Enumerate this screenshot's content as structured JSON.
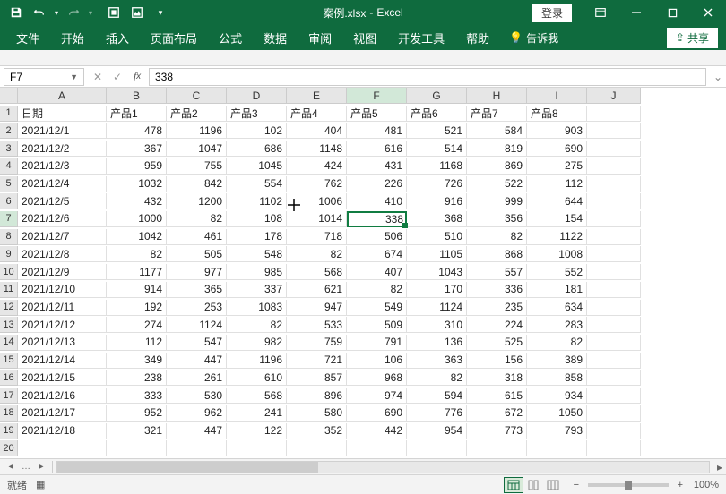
{
  "title": {
    "filename": "案例.xlsx",
    "app": "Excel"
  },
  "login": "登录",
  "ribbon": {
    "file": "文件",
    "home": "开始",
    "insert": "插入",
    "layout": "页面布局",
    "formula": "公式",
    "data": "数据",
    "review": "审阅",
    "view": "视图",
    "dev": "开发工具",
    "help": "帮助",
    "tellme": "告诉我",
    "share": "共享"
  },
  "namebox": "F7",
  "formula": "338",
  "cols": [
    "A",
    "B",
    "C",
    "D",
    "E",
    "F",
    "G",
    "H",
    "I",
    "J"
  ],
  "headRow": [
    "日期",
    "产品1",
    "产品2",
    "产品3",
    "产品4",
    "产品5",
    "产品6",
    "产品7",
    "产品8",
    ""
  ],
  "rows": [
    [
      "2021/12/1",
      "478",
      "1196",
      "102",
      "404",
      "481",
      "521",
      "584",
      "903",
      ""
    ],
    [
      "2021/12/2",
      "367",
      "1047",
      "686",
      "1148",
      "616",
      "514",
      "819",
      "690",
      ""
    ],
    [
      "2021/12/3",
      "959",
      "755",
      "1045",
      "424",
      "431",
      "1168",
      "869",
      "275",
      ""
    ],
    [
      "2021/12/4",
      "1032",
      "842",
      "554",
      "762",
      "226",
      "726",
      "522",
      "112",
      ""
    ],
    [
      "2021/12/5",
      "432",
      "1200",
      "1102",
      "1006",
      "410",
      "916",
      "999",
      "644",
      ""
    ],
    [
      "2021/12/6",
      "1000",
      "82",
      "108",
      "1014",
      "338",
      "368",
      "356",
      "154",
      ""
    ],
    [
      "2021/12/7",
      "1042",
      "461",
      "178",
      "718",
      "506",
      "510",
      "82",
      "1122",
      ""
    ],
    [
      "2021/12/8",
      "82",
      "505",
      "548",
      "82",
      "674",
      "1105",
      "868",
      "1008",
      ""
    ],
    [
      "2021/12/9",
      "1177",
      "977",
      "985",
      "568",
      "407",
      "1043",
      "557",
      "552",
      ""
    ],
    [
      "2021/12/10",
      "914",
      "365",
      "337",
      "621",
      "82",
      "170",
      "336",
      "181",
      ""
    ],
    [
      "2021/12/11",
      "192",
      "253",
      "1083",
      "947",
      "549",
      "1124",
      "235",
      "634",
      ""
    ],
    [
      "2021/12/12",
      "274",
      "1124",
      "82",
      "533",
      "509",
      "310",
      "224",
      "283",
      ""
    ],
    [
      "2021/12/13",
      "112",
      "547",
      "982",
      "759",
      "791",
      "136",
      "525",
      "82",
      ""
    ],
    [
      "2021/12/14",
      "349",
      "447",
      "1196",
      "721",
      "106",
      "363",
      "156",
      "389",
      ""
    ],
    [
      "2021/12/15",
      "238",
      "261",
      "610",
      "857",
      "968",
      "82",
      "318",
      "858",
      ""
    ],
    [
      "2021/12/16",
      "333",
      "530",
      "568",
      "896",
      "974",
      "594",
      "615",
      "934",
      ""
    ],
    [
      "2021/12/17",
      "952",
      "962",
      "241",
      "580",
      "690",
      "776",
      "672",
      "1050",
      ""
    ],
    [
      "2021/12/18",
      "321",
      "447",
      "122",
      "352",
      "442",
      "954",
      "773",
      "793",
      ""
    ],
    [
      "",
      "",
      "",
      "",
      "",
      "",
      "",
      "",
      "",
      ""
    ]
  ],
  "activeCell": {
    "row": 7,
    "col": 6
  },
  "status": {
    "ready": "就绪",
    "zoom": "100%"
  }
}
